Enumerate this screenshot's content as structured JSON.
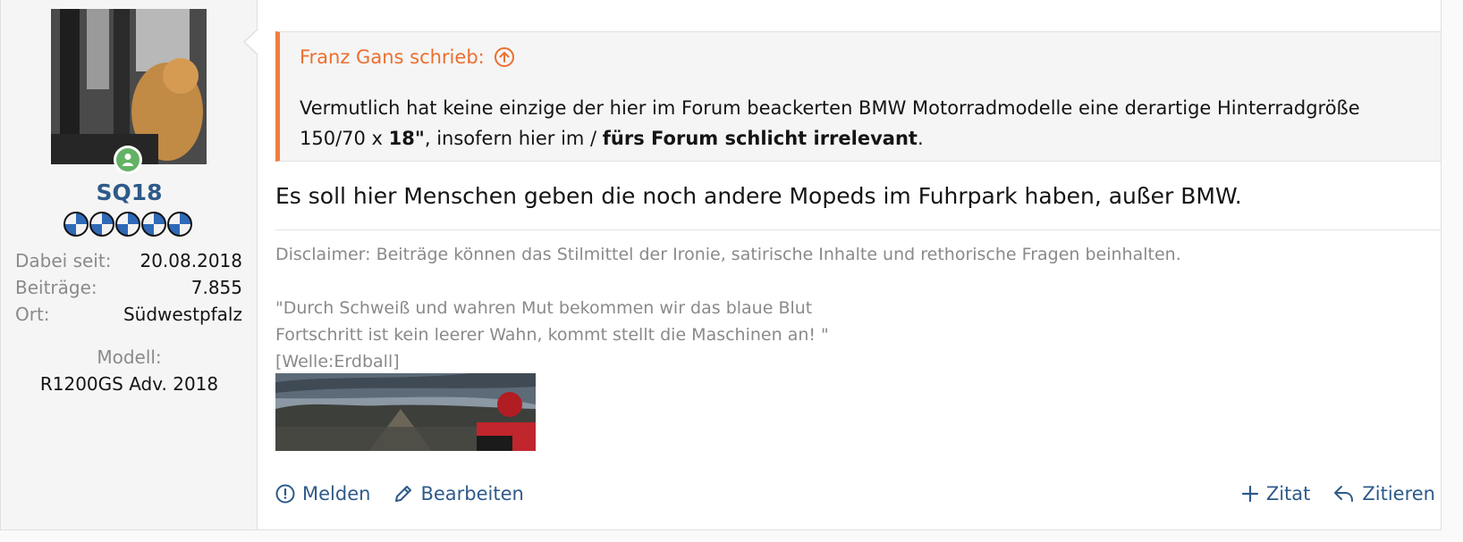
{
  "user": {
    "name": "SQ18",
    "stats": [
      {
        "label": "Dabei seit:",
        "value": "20.08.2018"
      },
      {
        "label": "Beiträge:",
        "value": "7.855"
      },
      {
        "label": "Ort:",
        "value": "Südwestpfalz"
      }
    ],
    "model_label": "Modell:",
    "model_value": "R1200GS Adv. 2018"
  },
  "quote": {
    "author": "Franz Gans schrieb:",
    "text_part1": "Vermutlich hat keine einzige der hier im Forum beackerten BMW Motorradmodelle eine derartige Hinterradgröße 150/70 x ",
    "text_bold1": "18\"",
    "text_part2": ", insofern hier im / ",
    "text_bold2": "fürs Forum schlicht irrelevant",
    "text_part3": "."
  },
  "post": {
    "text": "Es soll hier Menschen geben die noch andere Mopeds im Fuhrpark haben, außer BMW."
  },
  "signature": {
    "disclaimer": "Disclaimer: Beiträge können das Stilmittel der Ironie, satirische Inhalte und rethorische Fragen beinhalten.",
    "line1": "\"Durch Schweiß und wahren Mut bekommen wir das blaue Blut",
    "line2": "Fortschritt ist kein leerer Wahn, kommt stellt die Maschinen an! \"",
    "line3": "[Welle:Erdball]"
  },
  "actions": {
    "report": "Melden",
    "edit": "Bearbeiten",
    "multiquote": "Zitat",
    "quote": "Zitieren"
  },
  "colors": {
    "link": "#2e5a8a",
    "quote_accent": "#f07b3f",
    "online": "#63b265"
  }
}
